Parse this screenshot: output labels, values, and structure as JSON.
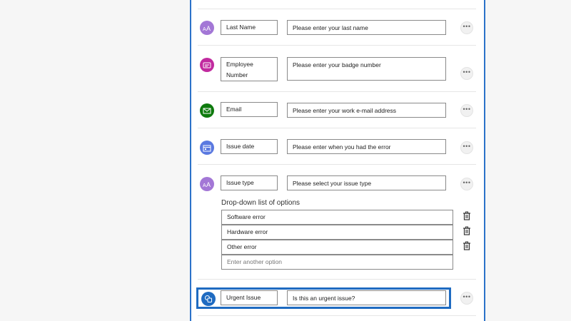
{
  "questions": [
    {
      "label": "Last Name",
      "placeholder": "Please enter your last name",
      "icon": "text-icon",
      "color": "#a377d6"
    },
    {
      "label": "Employee Number",
      "placeholder": "Please enter your badge number",
      "icon": "badge-icon",
      "color": "#c12a9f"
    },
    {
      "label": "Email",
      "placeholder": "Please enter your work e-mail address",
      "icon": "email-icon",
      "color": "#0e7a0d"
    },
    {
      "label": "Issue date",
      "placeholder": "Please enter when you had the error",
      "icon": "calendar-icon",
      "color": "#5a79e0"
    },
    {
      "label": "Issue type",
      "placeholder": "Please select your issue type",
      "icon": "text-icon",
      "color": "#a377d6"
    },
    {
      "label": "Urgent Issue",
      "placeholder": "Is this an urgent issue?",
      "icon": "yes-no-icon",
      "color": "#1f6bc1"
    }
  ],
  "dropdown": {
    "title": "Drop-down list of options",
    "options": [
      "Software error",
      "Hardware error",
      "Other error"
    ],
    "new_option_placeholder": "Enter another option"
  },
  "more_glyph": "•••",
  "employee_label_lines": [
    "Employee",
    "Number"
  ]
}
